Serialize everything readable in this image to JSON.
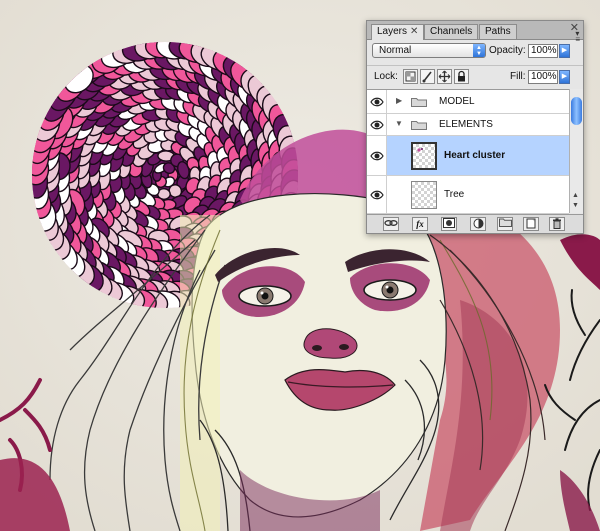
{
  "layers_panel": {
    "tabs": [
      {
        "label": "Layers",
        "close": "✕"
      },
      {
        "label": "Channels"
      },
      {
        "label": "Paths"
      }
    ],
    "panel_close": "✕",
    "blend_mode": "Normal",
    "opacity_label": "Opacity:",
    "opacity_value": "100%",
    "lock_label": "Lock:",
    "fill_label": "Fill:",
    "fill_value": "100%",
    "layers": [
      {
        "name": "MODEL",
        "type": "folder",
        "expanded": false,
        "visible": true,
        "selected": false
      },
      {
        "name": "ELEMENTS",
        "type": "folder",
        "expanded": true,
        "visible": true,
        "selected": false
      },
      {
        "name": "Heart cluster",
        "type": "layer",
        "visible": true,
        "selected": true
      },
      {
        "name": "Tree",
        "type": "layer",
        "visible": true,
        "selected": false
      }
    ],
    "footer_fx": "fx",
    "colors": {
      "selection": "#b5d3ff",
      "accent_blue": "#2f74d8",
      "panel_bg": "#e6e6e6"
    }
  },
  "artwork": {
    "colors": {
      "background": "#e9e5dc",
      "magenta": "#f0579a",
      "plum": "#6a1763",
      "pale_pink": "#ecc9d6",
      "skin_wash": "#f1efe0",
      "rose": "#c9576b"
    }
  }
}
